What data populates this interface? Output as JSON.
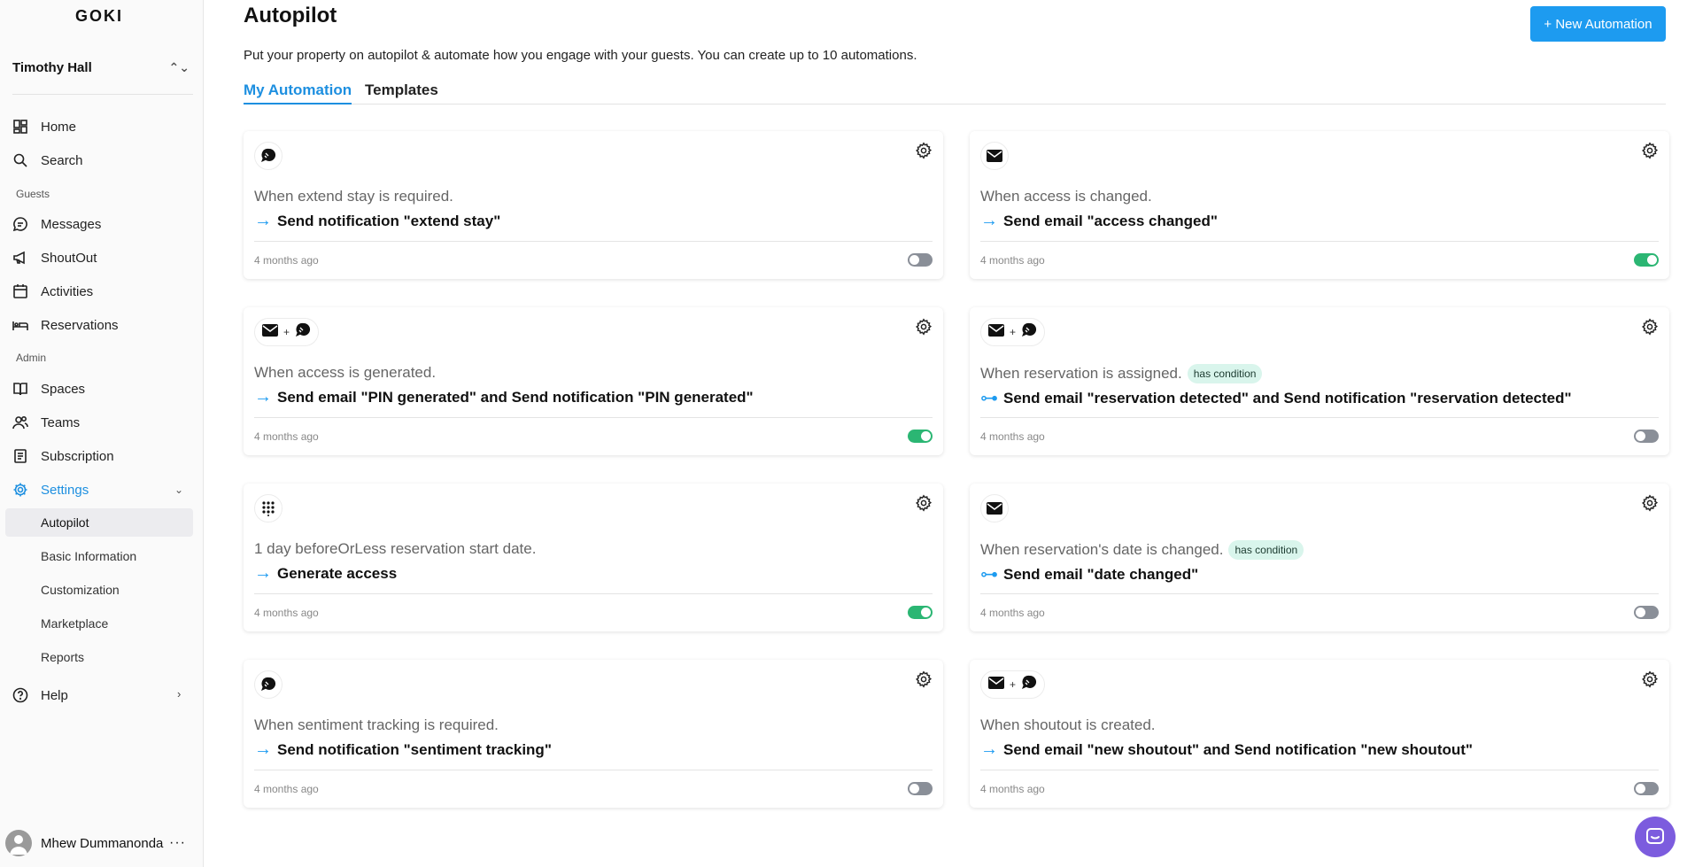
{
  "sidebar": {
    "logo": "GOKI",
    "org_name": "Timothy Hall",
    "items": {
      "home": "Home",
      "search": "Search",
      "guests_label": "Guests",
      "messages": "Messages",
      "shoutout": "ShoutOut",
      "activities": "Activities",
      "reservations": "Reservations",
      "admin_label": "Admin",
      "spaces": "Spaces",
      "teams": "Teams",
      "subscription": "Subscription",
      "settings": "Settings",
      "help": "Help"
    },
    "settings_sub": [
      "Autopilot",
      "Basic Information",
      "Customization",
      "Marketplace",
      "Reports"
    ],
    "user_name": "Mhew Dummanonda"
  },
  "main": {
    "title": "Autopilot",
    "new_button": "+ New Automation",
    "description": "Put your property on autopilot & automate how you engage with your guests. You can create up to 10 automations.",
    "tabs": [
      "My Automation",
      "Templates"
    ]
  },
  "cards": [
    {
      "trigger": "When extend stay is required.",
      "action": "Send notification \"extend stay\"",
      "time": "4 months ago",
      "enabled": false,
      "condition": ""
    },
    {
      "trigger": "When access is changed.",
      "action": "Send email \"access changed\"",
      "time": "4 months ago",
      "enabled": true,
      "condition": ""
    },
    {
      "trigger": "When access is generated.",
      "action": "Send email \"PIN generated\" and Send notification \"PIN generated\"",
      "time": "4 months ago",
      "enabled": true,
      "condition": ""
    },
    {
      "trigger": "When reservation is assigned.",
      "action": "Send email \"reservation detected\" and Send notification \"reservation detected\"",
      "time": "4 months ago",
      "enabled": false,
      "condition": "has condition"
    },
    {
      "trigger": "1 day beforeOrLess reservation start date.",
      "action": "Generate access",
      "time": "4 months ago",
      "enabled": true,
      "condition": ""
    },
    {
      "trigger": "When reservation's date is changed.",
      "action": "Send email \"date changed\"",
      "time": "4 months ago",
      "enabled": false,
      "condition": "has condition"
    },
    {
      "trigger": "When sentiment tracking is required.",
      "action": "Send notification \"sentiment tracking\"",
      "time": "4 months ago",
      "enabled": false,
      "condition": ""
    },
    {
      "trigger": "When shoutout is created.",
      "action": "Send email \"new shoutout\" and Send notification \"new shoutout\"",
      "time": "4 months ago",
      "enabled": false,
      "condition": ""
    }
  ],
  "colors": {
    "accent": "#1d9bf0",
    "toggle_on": "#2bb673",
    "toggle_off": "#8a8f98",
    "badge_bg": "#d9f5ec",
    "chat": "#7c5cde"
  }
}
